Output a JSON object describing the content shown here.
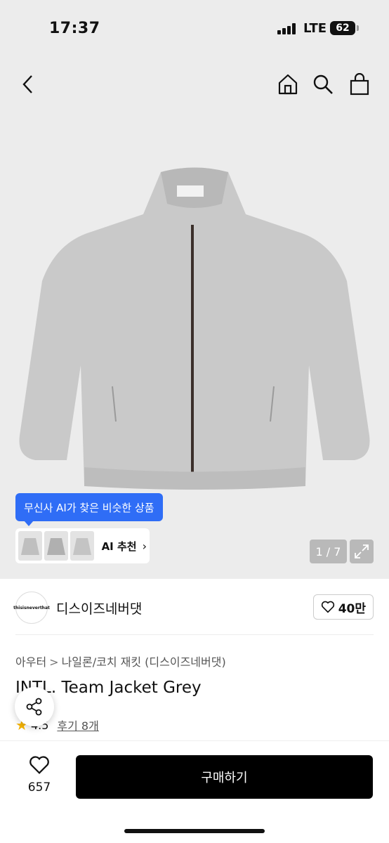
{
  "status": {
    "time": "17:37",
    "network": "LTE",
    "battery": "62"
  },
  "nav": {
    "back_icon": "chevron-left-icon",
    "home_icon": "home-icon",
    "search_icon": "search-icon",
    "bag_icon": "shopping-bag-icon"
  },
  "hero": {
    "jacket_logo": "thisisneverthat",
    "ai_tooltip": "무신사 AI가 찾은 비슷한 상품",
    "ai_recommend_label": "AI 추천",
    "ai_chevron": "›",
    "page_indicator": "1 / 7"
  },
  "brand": {
    "logo_text": "thisisneverthat",
    "name": "디스이즈네버댓",
    "likes": "40만"
  },
  "breadcrumb": {
    "category": "아우터",
    "separator": ">",
    "subcategory": "나일론/코치 재킷 (디스이즈네버댓)"
  },
  "product": {
    "title": "INTL. Team Jacket Grey",
    "rating": "4.5",
    "reviews": "후기 8개"
  },
  "bottom": {
    "wish_count": "657",
    "buy_label": "구매하기"
  },
  "colors": {
    "accent": "#2f6df6",
    "primary_button": "#000000",
    "star": "#f6b400",
    "hero_bg": "#ececec"
  }
}
